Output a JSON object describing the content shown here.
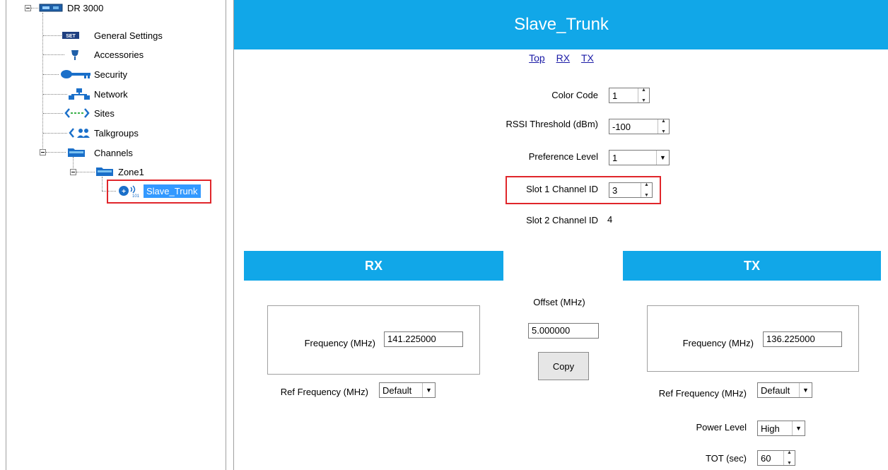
{
  "tree": {
    "root": "DR 3000",
    "items": [
      "General Settings",
      "Accessories",
      "Security",
      "Network",
      "Sites",
      "Talkgroups"
    ],
    "channels": "Channels",
    "zone": "Zone1",
    "selected": "Slave_Trunk"
  },
  "main": {
    "title": "Slave_Trunk",
    "links": [
      "Top",
      "RX",
      "TX"
    ],
    "fields": {
      "color_code": {
        "label": "Color Code",
        "value": "1"
      },
      "rssi": {
        "label": "RSSI Threshold (dBm)",
        "value": "-100"
      },
      "preference": {
        "label": "Preference Level",
        "value": "1"
      },
      "slot1": {
        "label": "Slot 1 Channel ID",
        "value": "3"
      },
      "slot2": {
        "label": "Slot 2 Channel ID",
        "value": "4"
      }
    },
    "rx": {
      "title": "RX",
      "freq_label": "Frequency (MHz)",
      "freq_value": "141.225000",
      "ref_label": "Ref Frequency (MHz)",
      "ref_value": "Default"
    },
    "offset": {
      "label": "Offset (MHz)",
      "value": "5.000000",
      "copy_label": "Copy"
    },
    "tx": {
      "title": "TX",
      "freq_label": "Frequency (MHz)",
      "freq_value": "136.225000",
      "ref_label": "Ref Frequency (MHz)",
      "ref_value": "Default",
      "power_label": "Power Level",
      "power_value": "High",
      "tot_label": "TOT (sec)",
      "tot_value": "60"
    }
  },
  "colors": {
    "accent": "#11a7e8",
    "highlight": "#e0262b",
    "selection": "#3399ff"
  }
}
